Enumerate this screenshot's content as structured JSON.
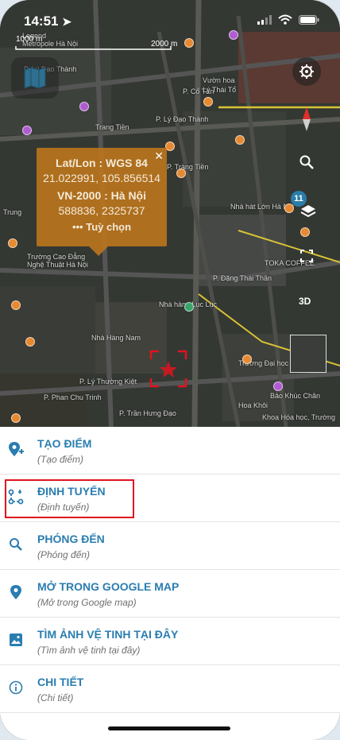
{
  "status_bar": {
    "time": "14:51"
  },
  "map": {
    "scale_label_1": "1000 m",
    "scale_label_2": "2000 m",
    "labels": [
      "Legend",
      "Metropole Hà Nội",
      "P. Lý Đạo Thành",
      "P. Lý Đạo Thành",
      "P. Cổ Tân",
      "Vườn hoa",
      "Lý Thái Tổ",
      "Trang Tiền",
      "P. Tràng Tiền",
      "Trung",
      "Nhà hát Lớn Hà Nội",
      "Trường Cao Đẳng",
      "Nghệ Thuật Hà Nội",
      "P. Đặng Thái Thân",
      "Nhà hàng Lục Lục",
      "Nhà Hàng Nam",
      "P. Lý Thường Kiệt",
      "P. Phan Chu Trinh",
      "Trường Đại học",
      "Bảo Khúc Chân",
      "Hoa Khôi",
      "Khoa Hóa học, Trường",
      "P. Trần Hưng Đạo",
      "TOKA COFFEE"
    ]
  },
  "popup": {
    "title_1": "Lat/Lon : WGS 84",
    "value_1": "21.022991, 105.856514",
    "title_2": "VN-2000 : Hà Nội",
    "value_2": "588836, 2325737",
    "options": "••• Tuỳ chọn",
    "close": "✕"
  },
  "controls": {
    "layers_badge": "11",
    "btn_3d": "3D"
  },
  "menu": {
    "items": [
      {
        "title": "TẠO ĐIỂM",
        "subtitle": "(Tạo điểm)"
      },
      {
        "title": "ĐỊNH TUYẾN",
        "subtitle": "(Định tuyến)"
      },
      {
        "title": "PHÓNG ĐẾN",
        "subtitle": "(Phóng đến)"
      },
      {
        "title": "MỞ TRONG GOOGLE MAP",
        "subtitle": "(Mở trong Google map)"
      },
      {
        "title": "TÌM ẢNH VỆ TINH TẠI ĐÂY",
        "subtitle": "(Tìm ảnh vệ tinh tại đây)"
      },
      {
        "title": "CHI TIẾT",
        "subtitle": "(Chi tiết)"
      }
    ]
  },
  "colors": {
    "accent": "#2a7db0",
    "popup": "#bf761b",
    "highlight": "#e0141e"
  }
}
